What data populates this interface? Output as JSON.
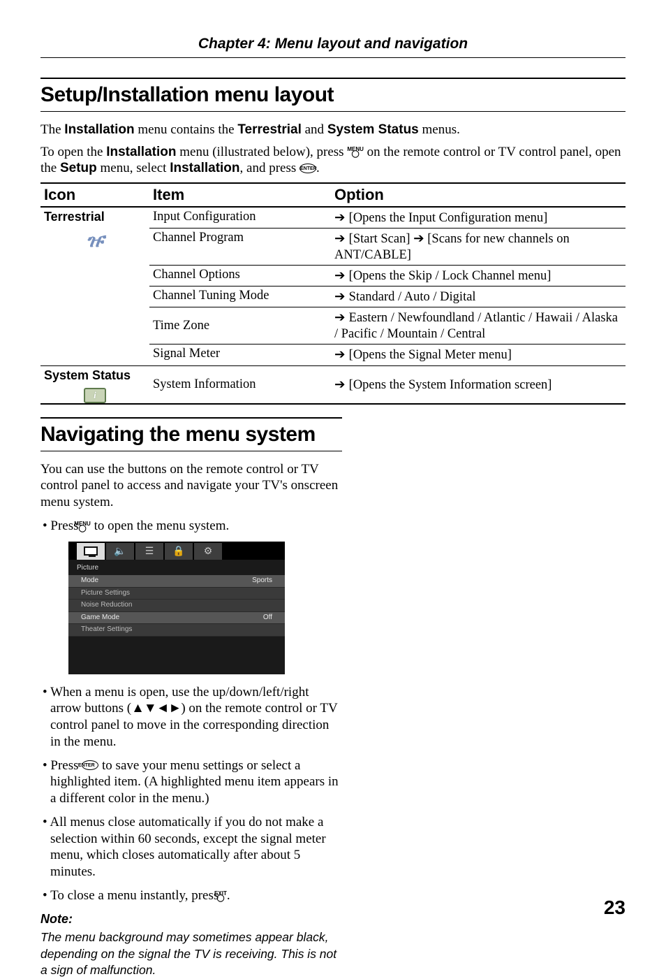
{
  "chapter_heading": "Chapter 4: Menu layout and navigation",
  "section1": {
    "title": "Setup/Installation menu layout",
    "intro1_pre": "The ",
    "intro1_b1": "Installation",
    "intro1_mid": " menu contains the ",
    "intro1_b2": "Terrestrial",
    "intro1_and": " and ",
    "intro1_b3": "System Status",
    "intro1_post": " menus.",
    "intro2_pre": "To open the ",
    "intro2_b1": "Installation",
    "intro2_mid1": " menu (illustrated below), press ",
    "intro2_icon1_label": "MENU",
    "intro2_mid2": " on the remote control or TV control panel, open the ",
    "intro2_b2": "Setup",
    "intro2_mid3": " menu, select ",
    "intro2_b3": "Installation",
    "intro2_mid4": ", and press ",
    "intro2_icon2_label": "ENTER",
    "intro2_post": "."
  },
  "table": {
    "headers": {
      "icon": "Icon",
      "item": "Item",
      "option": "Option"
    },
    "group1_label": "Terrestrial",
    "group1_rows": [
      {
        "item": "Input Configuration",
        "option": "[Opens the Input Configuration menu]"
      },
      {
        "item": "Channel Program",
        "option": "[Start Scan] ➔ [Scans for new channels on ANT/CABLE]"
      },
      {
        "item": "Channel Options",
        "option": "[Opens the Skip / Lock Channel menu]"
      },
      {
        "item": "Channel Tuning Mode",
        "option": "Standard / Auto / Digital"
      },
      {
        "item": "Time Zone",
        "option": "Eastern / Newfoundland / Atlantic / Hawaii / Alaska / Pacific / Mountain / Central"
      },
      {
        "item": "Signal Meter",
        "option": "[Opens the Signal Meter menu]"
      }
    ],
    "group2_label": "System Status",
    "group2_rows": [
      {
        "item": "System Information",
        "option": "[Opens the System Information screen]"
      }
    ]
  },
  "section2": {
    "title": "Navigating the menu system",
    "para1": "You can use the buttons on the remote control or TV control panel to access and navigate your TV's onscreen menu system.",
    "bullet1_pre": "Press ",
    "bullet1_icon": "MENU",
    "bullet1_post": " to open the menu system.",
    "osd": {
      "section_label": "Picture",
      "rows": [
        {
          "label": "Mode",
          "value": "Sports"
        },
        {
          "label": "Picture Settings",
          "value": ""
        },
        {
          "label": "Noise Reduction",
          "value": ""
        },
        {
          "label": "Game Mode",
          "value": "Off"
        },
        {
          "label": "Theater Settings",
          "value": ""
        }
      ]
    },
    "bullet2_pre": "When a menu is open, use the up/down/left/right arrow buttons (",
    "bullet2_glyph": "▲▼◄►",
    "bullet2_post": ") on the remote control or TV control panel to move in the corresponding direction in the menu.",
    "bullet3_pre": "Press ",
    "bullet3_icon": "ENTER",
    "bullet3_post": " to save your menu settings or select a highlighted item. (A highlighted menu item appears in a different color in the menu.)",
    "bullet4": "All menus close automatically if you do not make a selection within 60 seconds, except the signal meter menu, which closes automatically after about 5 minutes.",
    "bullet5_pre": "To close a menu instantly, press ",
    "bullet5_icon": "EXIT",
    "bullet5_post": ".",
    "note_head": "Note:",
    "note_body": "The menu background may sometimes appear black, depending on the signal the TV is receiving. This is not a sign of malfunction."
  },
  "page_number": "23"
}
